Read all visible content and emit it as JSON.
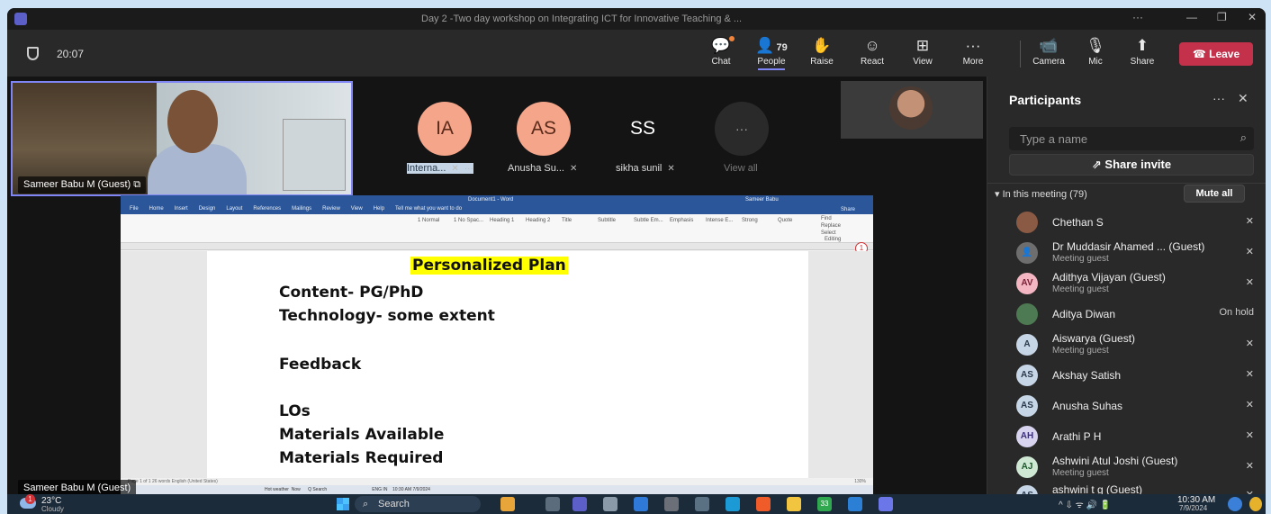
{
  "window": {
    "title": "Day 2 -Two day workshop on Integrating ICT for Innovative Teaching & ...",
    "more": "···",
    "minimize": "—",
    "restore": "❐",
    "close": "✕"
  },
  "toolbar": {
    "time": "20:07",
    "chat": "Chat",
    "people": "People",
    "people_count": "79",
    "raise": "Raise",
    "react": "React",
    "view": "View",
    "more": "More",
    "camera": "Camera",
    "mic": "Mic",
    "share": "Share",
    "leave": "Leave"
  },
  "stage": {
    "main_name": "Sameer Babu M (Guest)",
    "tiles": [
      {
        "initials": "IA",
        "label": "Interna...",
        "color": "#f4a58a",
        "text_color": "#5a2a1a"
      },
      {
        "initials": "AS",
        "label": "Anusha Su...",
        "color": "#c7d6e6",
        "text_color": "#2a3a4d"
      },
      {
        "initials": "SS",
        "label": "sikha sunil",
        "color": "#f4a58a",
        "text_color": "#5a2a1a"
      }
    ],
    "view_all": "View all",
    "view_all_dots": "···",
    "mute_glyph": "🎙̸",
    "more_dots": "···",
    "bottom_name": "Sameer Babu M (Guest)"
  },
  "word": {
    "title": "Document1 - Word",
    "user": "Sameer Babu",
    "tabs": [
      "File",
      "Home",
      "Insert",
      "Design",
      "Layout",
      "References",
      "Mailings",
      "Review",
      "View",
      "Help",
      "Tell me what you want to do"
    ],
    "share": "Share",
    "styles": [
      "1 Normal",
      "1 No Spac...",
      "Heading 1",
      "Heading 2",
      "Title",
      "Subtitle",
      "Subtle Em...",
      "Emphasis",
      "Intense E...",
      "Strong",
      "Quote"
    ],
    "find": "Find",
    "replace": "Replace",
    "select": "Select",
    "editing": "Editing",
    "doc_title": "Personalized Plan",
    "lines": [
      "Content- PG/PhD",
      "Technology- some extent",
      "Feedback",
      "LOs",
      "Materials Available",
      "Materials Required"
    ],
    "status": "Page 1 of 1   26 words   English (United States)",
    "zoom": "130%",
    "badge": "1",
    "inner_taskbar": "Hot weather  Now      Q Search                                    ENG IN    10:30 AM 7/9/2024"
  },
  "panel": {
    "title": "Participants",
    "more": "···",
    "close": "✕",
    "search_placeholder": "Type a name",
    "share_invite": "Share invite",
    "section": "In this meeting (79)",
    "mute_all": "Mute all",
    "participants": [
      {
        "initials": "",
        "name": "Chethan S",
        "sub": "",
        "state": "mic-off",
        "avatar_color": "#8a5a44",
        "text_color": "#fff"
      },
      {
        "initials": "",
        "name": "Dr Muddasir Ahamed ...  (Guest)",
        "sub": "Meeting guest",
        "state": "mic-off",
        "avatar_color": "#6e6e6e",
        "text_color": "#fff"
      },
      {
        "initials": "AV",
        "name": "Adithya Vijayan (Guest)",
        "sub": "Meeting guest",
        "state": "mic-off",
        "avatar_color": "#f3b6c2",
        "text_color": "#7a1f35"
      },
      {
        "initials": "",
        "name": "Aditya Diwan",
        "sub": "",
        "state": "On hold",
        "avatar_color": "#4d7a52",
        "text_color": "#fff"
      },
      {
        "initials": "A",
        "name": "Aiswarya (Guest)",
        "sub": "Meeting guest",
        "state": "mic-off",
        "avatar_color": "#c7d6e6",
        "text_color": "#2a3a4d"
      },
      {
        "initials": "AS",
        "name": "Akshay Satish",
        "sub": "",
        "state": "mic-off",
        "avatar_color": "#c7d6e6",
        "text_color": "#2a3a4d"
      },
      {
        "initials": "AS",
        "name": "Anusha Suhas",
        "sub": "",
        "state": "mic-off",
        "avatar_color": "#c7d6e6",
        "text_color": "#2a3a4d"
      },
      {
        "initials": "AH",
        "name": "Arathi P H",
        "sub": "",
        "state": "mic-off",
        "avatar_color": "#d8d4f0",
        "text_color": "#3b2f7a"
      },
      {
        "initials": "AJ",
        "name": "Ashwini Atul Joshi (Guest)",
        "sub": "Meeting guest",
        "state": "mic-off",
        "avatar_color": "#cfe8d4",
        "text_color": "#1f5a2c"
      },
      {
        "initials": "AS",
        "name": "ashwini t g (Guest)",
        "sub": "",
        "state": "mic-off",
        "avatar_color": "#c7d6e6",
        "text_color": "#2a3a4d"
      }
    ]
  },
  "taskbar": {
    "weather_badge": "1",
    "temp": "23°C",
    "weather": "Cloudy",
    "search": "Search",
    "tray": "^   ⇩   ᯤ  🔊  🔋",
    "time": "10:30 AM",
    "date": "7/9/2024",
    "notif_badge": "33"
  }
}
